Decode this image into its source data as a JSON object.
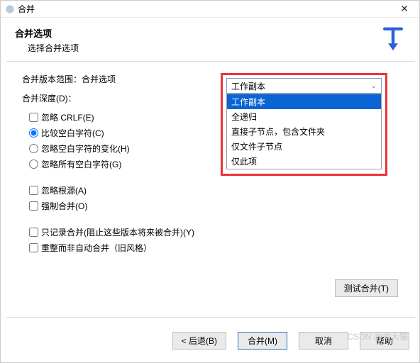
{
  "title": "合并",
  "header": {
    "h1": "合并选项",
    "sub": "选择合并选项"
  },
  "range": {
    "label": "合并版本范围：合并选项"
  },
  "depth": {
    "label": "合并深度(D)：",
    "selected": "工作副本",
    "options": [
      "工作副本",
      "全递归",
      "直接子节点，包含文件夹",
      "仅文件子节点",
      "仅此项"
    ]
  },
  "ignoreCrlf": "忽略 CRLF(E)",
  "ws": {
    "compare": "比较空白字符(C)",
    "ignoreChanges": "忽略空白字符的变化(H)",
    "ignoreAll": "忽略所有空白字符(G)"
  },
  "ignoreAncestry": "忽略根源(A)",
  "forceMerge": "强制合并(O)",
  "recordOnly": "只记录合并(阻止这些版本将来被合并)(Y)",
  "reintegrate": "重整而非自动合并（旧风格）",
  "testBtn": "测试合并(T)",
  "back": "< 后退(B)",
  "merge": "合并(M)",
  "cancel": "取消",
  "help": "帮助",
  "watermark": "CSDN @刘大猫"
}
